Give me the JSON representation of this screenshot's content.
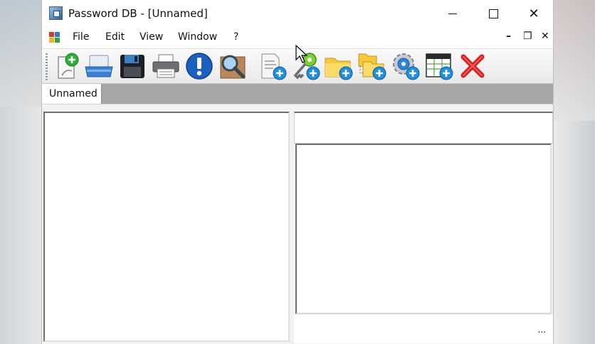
{
  "window": {
    "title": "Password DB - [Unnamed]"
  },
  "window_controls": {
    "minimize": "minimize-icon",
    "maximize": "maximize-icon",
    "close": "✕"
  },
  "menu": {
    "items": [
      "File",
      "Edit",
      "View",
      "Window",
      "?"
    ]
  },
  "mdi_controls": {
    "minimize": "–",
    "restore": "❐",
    "close": "✕"
  },
  "toolbar": {
    "buttons": [
      "new-database-icon",
      "open-database-icon",
      "save-icon",
      "print-icon",
      "info-icon",
      "search-icon",
      "add-entry-icon",
      "add-key-icon",
      "add-folder-icon",
      "add-subfolder-icon",
      "add-settings-icon",
      "add-table-icon",
      "delete-icon"
    ]
  },
  "tabs": [
    {
      "label": "Unnamed",
      "active": true
    }
  ],
  "statusbar": {
    "text": "..."
  },
  "colors": {
    "tabbar": "#a6a6a6",
    "accent_green": "#2fae3b",
    "accent_blue": "#1f6fc6",
    "delete_red": "#d42020"
  }
}
